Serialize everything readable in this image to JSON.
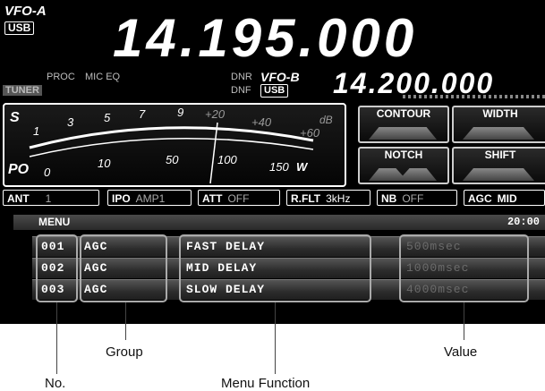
{
  "vfo_a": {
    "label": "VFO-A",
    "mode": "USB",
    "frequency": "14.195.000"
  },
  "vfo_b": {
    "label": "VFO-B",
    "mode": "USB",
    "frequency": "14.200.000"
  },
  "status": {
    "proc": "PROC",
    "mic_eq": "MIC EQ",
    "tuner": "TUNER",
    "dnr": "DNR",
    "dnf": "DNF"
  },
  "meter": {
    "s_label": "S",
    "po_label": "PO",
    "s_scale": [
      "1",
      "3",
      "5",
      "7",
      "9",
      "+20",
      "+40",
      "+60"
    ],
    "db_label": "dB",
    "po_scale": [
      "0",
      "10",
      "50",
      "100",
      "150"
    ],
    "po_unit": "W"
  },
  "filters": {
    "contour": "CONTOUR",
    "width": "WIDTH",
    "notch": "NOTCH",
    "shift": "SHIFT"
  },
  "function_bar": [
    {
      "name": "ANT",
      "value": "1"
    },
    {
      "name": "IPO",
      "value": "AMP1"
    },
    {
      "name": "ATT",
      "value": "OFF"
    },
    {
      "name": "R.FLT",
      "value": "3kHz"
    },
    {
      "name": "NB",
      "value": "OFF"
    },
    {
      "name": "AGC",
      "value": "MID"
    }
  ],
  "menu": {
    "title": "MENU",
    "time": "20:00",
    "rows": [
      {
        "no": "001",
        "group": "AGC",
        "function": "FAST DELAY",
        "value": "500msec"
      },
      {
        "no": "002",
        "group": "AGC",
        "function": "MID DELAY",
        "value": "1000msec"
      },
      {
        "no": "003",
        "group": "AGC",
        "function": "SLOW DELAY",
        "value": "4000msec"
      }
    ]
  },
  "callouts": {
    "no": "No.",
    "group": "Group",
    "function": "Menu Function",
    "value": "Value"
  }
}
